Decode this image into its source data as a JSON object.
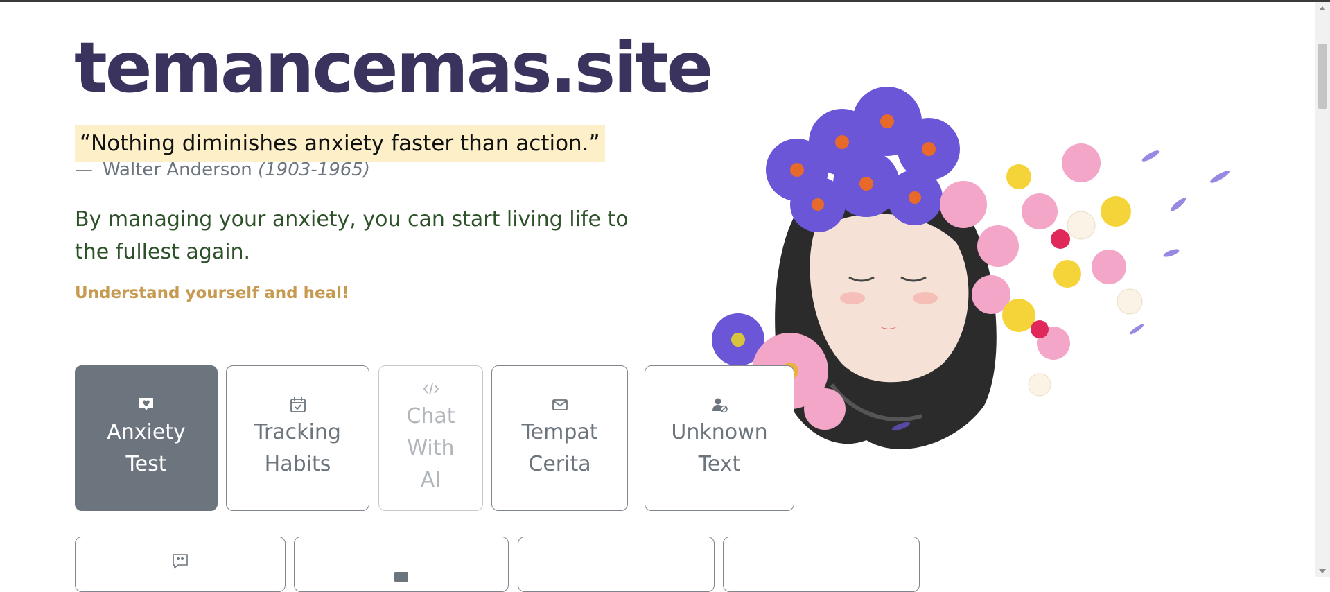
{
  "site": {
    "title": "temancemas.site"
  },
  "quote": {
    "text": "“Nothing diminishes anxiety faster than action.”",
    "dash": "—",
    "author": "Walter Anderson",
    "years": "(1903-1965)"
  },
  "tagline": "By managing your anxiety, you can start living life to the fullest again.",
  "cta": "Understand yourself and heal!",
  "hero": {
    "icon": "woman-with-flowers-illustration"
  },
  "menu": {
    "anxiety_test": {
      "label": "Anxiety\nTest",
      "icon": "heart-chat-icon",
      "state": "active"
    },
    "tracking_habits": {
      "label": "Tracking\nHabits",
      "icon": "calendar-check-icon"
    },
    "chat_with_ai": {
      "label": "Chat\nWith\nAI",
      "icon": "code-icon",
      "state": "disabled"
    },
    "tempat_cerita": {
      "label": "Tempat\nCerita",
      "icon": "envelope-icon"
    },
    "unknown_text": {
      "label": "Unknown\nText",
      "icon": "person-slash-icon"
    }
  },
  "menu_row2": {
    "item1": {
      "icon": "quote-chat-icon"
    },
    "item2": {
      "icon": "envelope-icon"
    }
  },
  "colors": {
    "title": "#3a335e",
    "quote_highlight": "#fdf0c9",
    "tagline": "#2d5128",
    "cta": "#c69a50",
    "button_active": "#6c757d"
  }
}
